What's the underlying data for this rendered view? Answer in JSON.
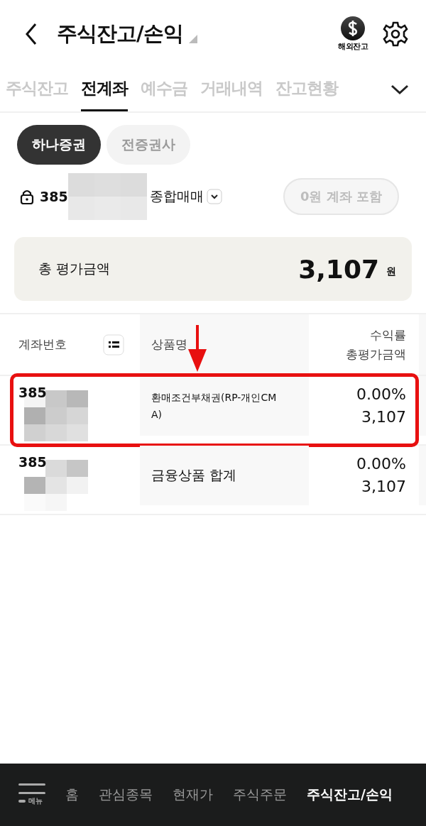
{
  "header": {
    "title": "주식잔고/손익",
    "overseas_label": "해외잔고"
  },
  "tabs": [
    {
      "label": "주식잔고",
      "selected": false
    },
    {
      "label": "전계좌",
      "selected": true
    },
    {
      "label": "예수금",
      "selected": false
    },
    {
      "label": "거래내역",
      "selected": false
    },
    {
      "label": "잔고현황",
      "selected": false
    }
  ],
  "chips": [
    {
      "label": "하나증권",
      "selected": true
    },
    {
      "label": "전증권사",
      "selected": false
    }
  ],
  "account": {
    "number_prefix": "385",
    "type": "종합매매",
    "zero_button": "0원 계좌 포함"
  },
  "summary": {
    "label": "총 평가금액",
    "amount": "3,107",
    "unit": "원"
  },
  "table": {
    "columns": [
      {
        "lines": [
          "계좌번호"
        ]
      },
      {
        "lines": [
          "상품명"
        ]
      },
      {
        "lines": [
          "수익률",
          "총평가금액"
        ]
      }
    ],
    "rows": [
      {
        "account": "385",
        "product": "환매조건부채권(RP-개인CMA)",
        "rate": "0.00%",
        "value": "3,107",
        "highlighted": true,
        "small": true
      },
      {
        "account": "385",
        "product": "금융상품 합계",
        "rate": "0.00%",
        "value": "3,107",
        "highlighted": false,
        "small": false
      }
    ]
  },
  "bottom_nav": {
    "menu_label": "메뉴",
    "items": [
      {
        "label": "홈",
        "selected": false
      },
      {
        "label": "관심종목",
        "selected": false
      },
      {
        "label": "현재가",
        "selected": false
      },
      {
        "label": "주식주문",
        "selected": false
      },
      {
        "label": "주식잔고/손익",
        "selected": true
      }
    ]
  }
}
